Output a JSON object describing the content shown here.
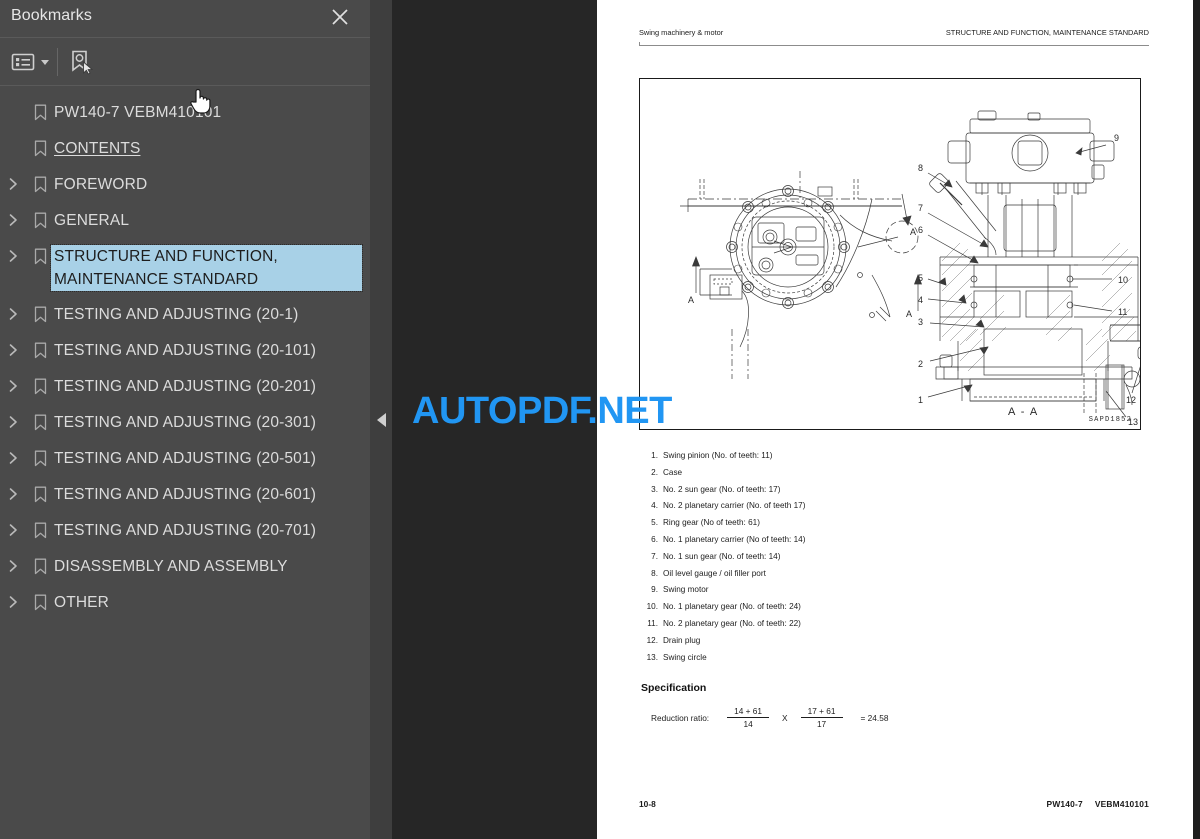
{
  "panel": {
    "title": "Bookmarks",
    "close_icon": "close-icon",
    "toolbar": {
      "options_icon": "list-options-icon",
      "options_caret": "chevron-down-icon",
      "new_bookmark_icon": "new-bookmark-icon"
    },
    "bookmarks": [
      {
        "label": "PW140-7   VEBM410101",
        "expandable": false,
        "selected": false,
        "underline": false
      },
      {
        "label": "CONTENTS",
        "expandable": false,
        "selected": false,
        "underline": true
      },
      {
        "label": "FOREWORD",
        "expandable": true,
        "selected": false,
        "underline": false
      },
      {
        "label": "GENERAL",
        "expandable": true,
        "selected": false,
        "underline": false
      },
      {
        "label": "STRUCTURE AND FUNCTION,\nMAINTENANCE STANDARD",
        "expandable": true,
        "selected": true,
        "underline": false
      },
      {
        "label": "TESTING AND ADJUSTING (20-1)",
        "expandable": true,
        "selected": false,
        "underline": false
      },
      {
        "label": "TESTING AND ADJUSTING (20-101)",
        "expandable": true,
        "selected": false,
        "underline": false
      },
      {
        "label": "TESTING AND ADJUSTING (20-201)",
        "expandable": true,
        "selected": false,
        "underline": false
      },
      {
        "label": "TESTING AND ADJUSTING (20-301)",
        "expandable": true,
        "selected": false,
        "underline": false
      },
      {
        "label": "TESTING AND ADJUSTING (20-501)",
        "expandable": true,
        "selected": false,
        "underline": false
      },
      {
        "label": "TESTING AND ADJUSTING (20-601)",
        "expandable": true,
        "selected": false,
        "underline": false
      },
      {
        "label": "TESTING AND ADJUSTING (20-701)",
        "expandable": true,
        "selected": false,
        "underline": false
      },
      {
        "label": "DISASSEMBLY AND ASSEMBLY",
        "expandable": true,
        "selected": false,
        "underline": false
      },
      {
        "label": "OTHER",
        "expandable": true,
        "selected": false,
        "underline": false
      }
    ],
    "collapse_handle_icon": "triangle-left-icon"
  },
  "document": {
    "header_left": "Swing machinery & motor",
    "header_right": "STRUCTURE AND FUNCTION, MAINTENANCE STANDARD",
    "figure": {
      "drawing_number": "SAPD1852",
      "section_label_a": "A",
      "section_view_label": "A - A",
      "callouts": [
        "1",
        "2",
        "3",
        "4",
        "5",
        "6",
        "7",
        "8",
        "9",
        "10",
        "11",
        "12",
        "13"
      ]
    },
    "parts": [
      {
        "n": "1.",
        "text": "Swing pinion (No. of teeth: 11)"
      },
      {
        "n": "2.",
        "text": "Case"
      },
      {
        "n": "3.",
        "text": "No. 2 sun gear (No. of teeth: 17)"
      },
      {
        "n": "4.",
        "text": "No. 2 planetary carrier (No. of teeth 17)"
      },
      {
        "n": "5.",
        "text": "Ring gear (No of teeth: 61)"
      },
      {
        "n": "6.",
        "text": "No. 1 planetary carrier (No of teeth: 14)"
      },
      {
        "n": "7.",
        "text": "No. 1 sun gear (No. of teeth: 14)"
      },
      {
        "n": "8.",
        "text": "Oil level gauge / oil filler port"
      },
      {
        "n": "9.",
        "text": "Swing motor"
      },
      {
        "n": "10.",
        "text": "No. 1 planetary gear (No. of teeth: 24)"
      },
      {
        "n": "11.",
        "text": "No. 2 planetary gear (No. of teeth: 22)"
      },
      {
        "n": "12.",
        "text": "Drain plug"
      },
      {
        "n": "13.",
        "text": "Swing circle"
      }
    ],
    "spec": {
      "title": "Specification",
      "label": "Reduction ratio:",
      "frac1_num": "14 + 61",
      "frac1_den": "14",
      "times": "X",
      "frac2_num": "17 + 61",
      "frac2_den": "17",
      "result": "= 24.58"
    },
    "footer_page": "10-8",
    "footer_model": "PW140-7",
    "footer_code": "VEBM410101"
  },
  "watermark": {
    "text": "AUTOPDF.NET",
    "color": "#2196f3"
  },
  "cursor": {
    "icon": "hand-pointer-cursor"
  }
}
